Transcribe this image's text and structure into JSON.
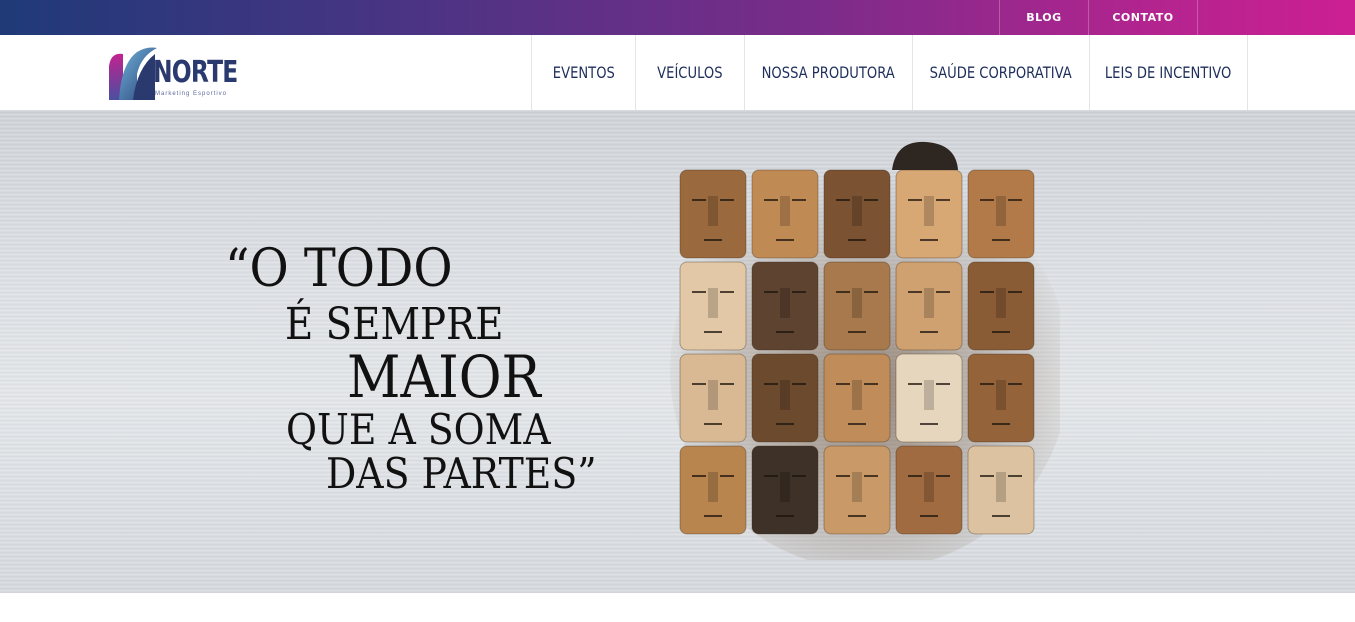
{
  "topbar": {
    "links": [
      "BLOG",
      "CONTATO"
    ]
  },
  "header": {
    "logo": {
      "name": "NORTE",
      "tagline": "Marketing Esportivo"
    },
    "nav": [
      "EVENTOS",
      "VEÍCULOS",
      "NOSSA PRODUTORA",
      "SAÚDE CORPORATIVA",
      "LEIS DE INCENTIVO"
    ]
  },
  "hero": {
    "quote_lines": [
      "“O TODO",
      "É SEMPRE",
      "MAIOR",
      "QUE A SOMA",
      "DAS PARTES”"
    ],
    "image": "wooden-faces-mosaic"
  },
  "colors": {
    "gradient_start": "#1f3a78",
    "gradient_end": "#cc1f93",
    "nav_text": "#1e2f5c"
  }
}
